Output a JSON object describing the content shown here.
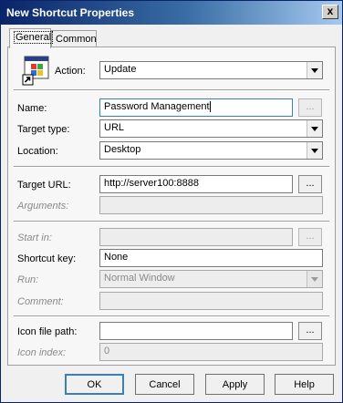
{
  "window": {
    "title": "New Shortcut Properties",
    "close_label": "x"
  },
  "tabs": [
    {
      "label": "General"
    },
    {
      "label": "Common"
    }
  ],
  "action": {
    "label": "Action:",
    "value": "Update"
  },
  "name": {
    "label": "Name:",
    "value": "Password Management"
  },
  "target_type": {
    "label": "Target type:",
    "value": "URL"
  },
  "location": {
    "label": "Location:",
    "value": "Desktop"
  },
  "target_url": {
    "label": "Target URL:",
    "value": "http://server100:8888"
  },
  "arguments": {
    "label": "Arguments:",
    "value": ""
  },
  "start_in": {
    "label": "Start in:",
    "value": ""
  },
  "shortcut_key": {
    "label": "Shortcut key:",
    "value": "None"
  },
  "run": {
    "label": "Run:",
    "value": "Normal Window"
  },
  "comment": {
    "label": "Comment:",
    "value": ""
  },
  "icon_file_path": {
    "label": "Icon file path:",
    "value": ""
  },
  "icon_index": {
    "label": "Icon index:",
    "value": "0"
  },
  "browse_label": "...",
  "buttons": {
    "ok": "OK",
    "cancel": "Cancel",
    "apply": "Apply",
    "help": "Help"
  },
  "colors": {
    "titlebar_start": "#0a246a",
    "titlebar_end": "#a6caf0",
    "focus_border": "#3c7fb1"
  },
  "icons": {
    "action": "shortcut-window-icon"
  }
}
